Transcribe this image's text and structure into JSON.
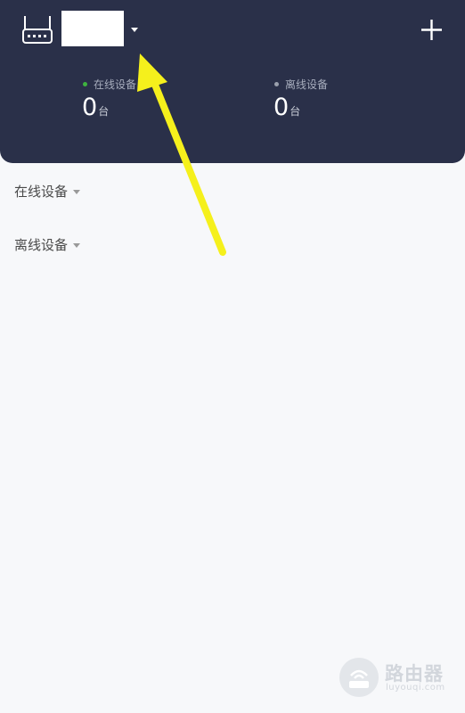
{
  "header": {
    "router_icon": "router-icon",
    "dropdown_icon": "caret-down-icon",
    "add_icon": "plus-icon"
  },
  "stats": {
    "online": {
      "label": "在线设备",
      "value": "0",
      "unit": "台",
      "dot_color": "#3fb33f"
    },
    "offline": {
      "label": "离线设备",
      "value": "0",
      "unit": "台",
      "dot_color": "#9aa0ad"
    }
  },
  "sections": {
    "online_label": "在线设备",
    "offline_label": "离线设备"
  },
  "colors": {
    "header_bg": "#2a3049",
    "page_bg": "#f7f8fa",
    "annotation_arrow": "#f5f01c"
  },
  "watermark": {
    "name": "路由器",
    "domain": "luyouqi.com"
  }
}
